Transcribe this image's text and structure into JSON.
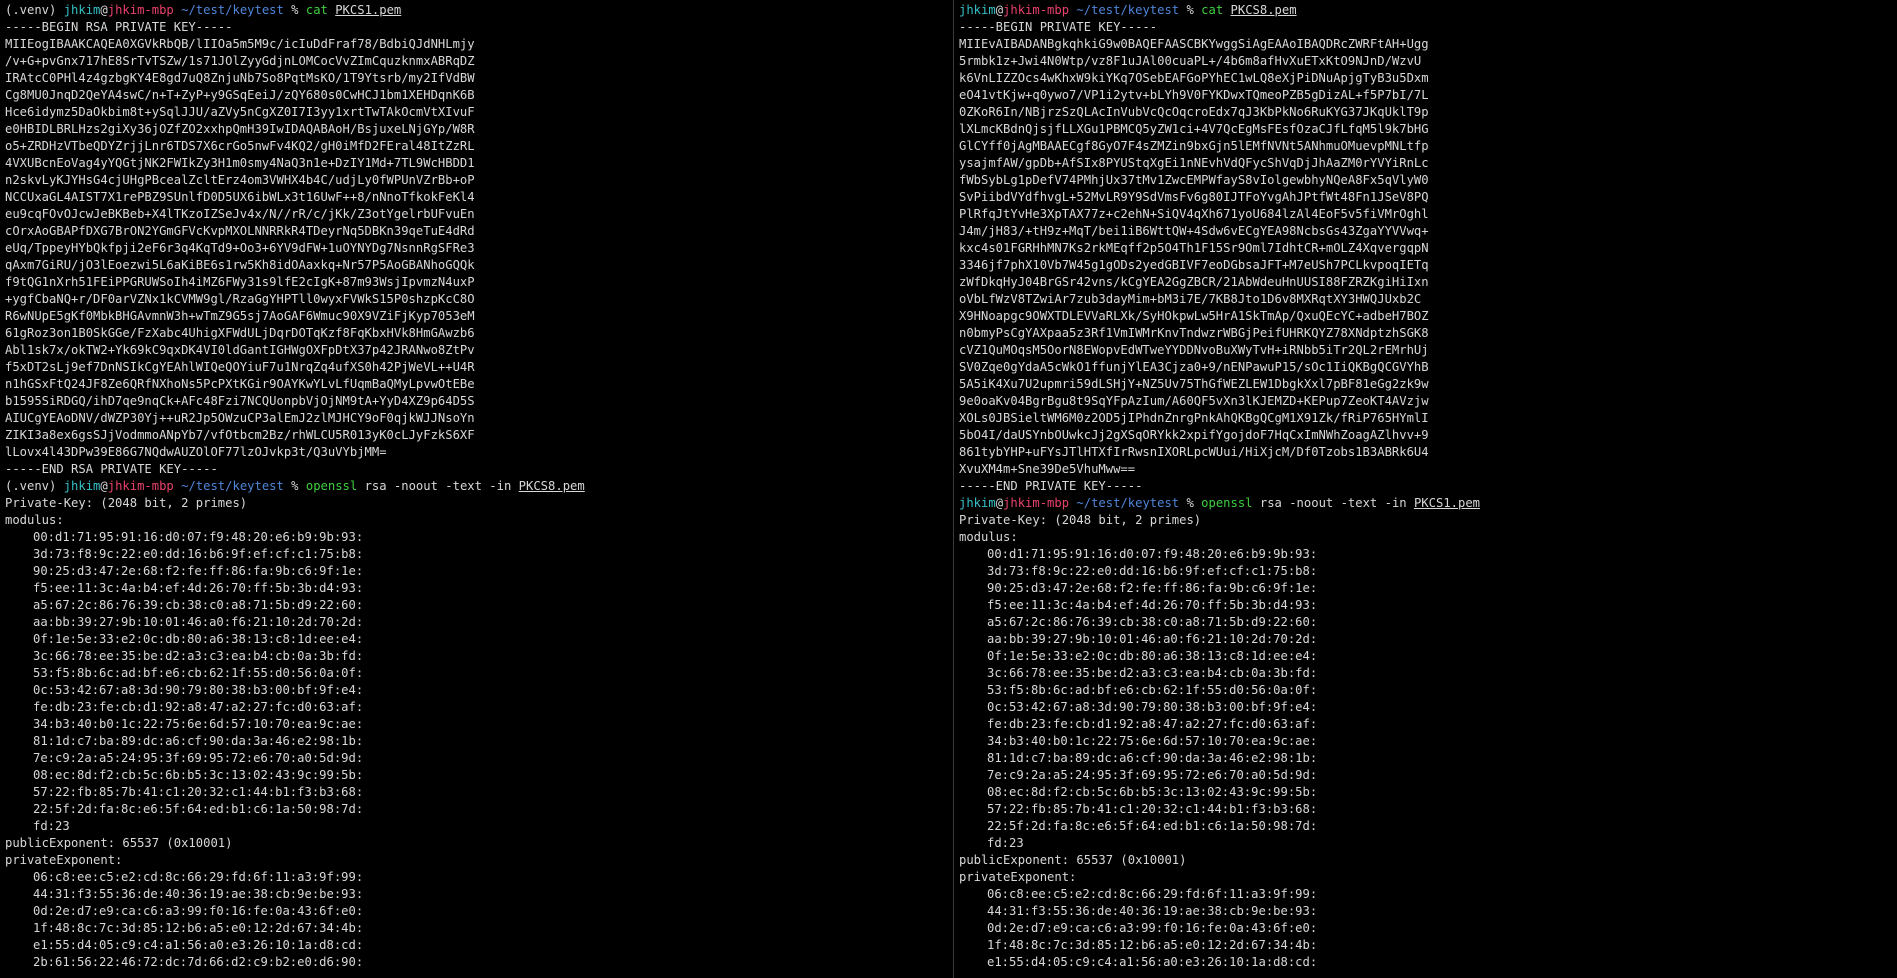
{
  "left": {
    "prompt1": {
      "venv": "(.venv) ",
      "user": "jhkim",
      "at": "@",
      "host": "jhkim-mbp",
      "path": " ~/test/keytest",
      "sym": " % ",
      "cmd": "cat",
      "arg": " ",
      "file": "PKCS1.pem"
    },
    "key_lines": [
      "-----BEGIN RSA PRIVATE KEY-----",
      "MIIEogIBAAKCAQEA0XGVkRbQB/lIIOa5m5M9c/icIuDdFraf78/BdbiQJdNHLmjy",
      "/v+G+pvGnx717hE8SrTvTSZw/1s71JOlZyyGdjnLOMCocVvZImCquzknmxABRqDZ",
      "IRAtcC0PHl4z4gzbgKY4E8gd7uQ8ZnjuNb7So8PqtMsKO/1T9Ytsrb/my2IfVdBW",
      "Cg8MU0JnqD2QeYA4swC/n+T+ZyP+y9GSqEeiJ/zQY680s0CwHCJ1bm1XEHDqnK6B",
      "Hce6idymz5DaOkbim8t+ySqlJJU/aZVy5nCgXZ0I7I3yy1xrtTwTAkOcmVtXIvuF",
      "e0HBIDLBRLHzs2giXy36jOZfZO2xxhpQmH39IwIDAQABAoH/BsjuxeLNjGYp/W8R",
      "o5+ZRDHzVTbeQDYZrjjLnr6TDS7X6crGo5nwFv4KQ2/gH0iMfD2FEral48ItZzRL",
      "4VXUBcnEoVag4yYQGtjNK2FWIkZy3H1m0smy4NaQ3n1e+DzIY1Md+7TL9WcHBDD1",
      "n2skvLyKJYHsG4cjUHgPBcealZcltErz4om3VWHX4b4C/udjLy0fWPUnVZrBb+oP",
      "NCCUxaGL4AIST7X1rePBZ9SUnlfD0D5UX6ibWLx3t16UwF++8/nNnoTfkokFeKl4",
      "eu9cqFOvOJcwJeBKBeb+X4lTKzoIZSeJv4x/N//rR/c/jKk/Z3otYgelrbUFvuEn",
      "cOrxAoGBAPfDXG7BrON2YGmGFVcKvpMXOLNNRRkR4TDeyrNq5DBKn39qeTuE4dRd",
      "eUq/TppeyHYbQkfpji2eF6r3q4KqTd9+Oo3+6YV9dFW+1uOYNYDg7NsnnRgSFRe3",
      "qAxm7GiRU/jO3lEoezwi5L6aKiBE6s1rw5Kh8idOAaxkq+Nr57P5AoGBANhoGQQk",
      "f9tQG1nXrh51FEiPPGRUWSoIh4iMZ6FWy31s9lfE2cIgK+87m93WsjIpvmzN4uxP",
      "+ygfCbaNQ+r/DF0arVZNx1kCVMW9gl/RzaGgYHPTll0wyxFVWkS15P0shzpKcC8O",
      "R6wNUpE5gKf0MbkBHGAvmnW3h+wTmZ9G5sj7AoGAF6Wmuc90X9VZiFjKyp7053eM",
      "61gRoz3on1B0SkGGe/FzXabc4UhigXFWdULjDqrDOTqKzf8FqKbxHVk8HmGAwzb6",
      "Abl1sk7x/okTW2+Yk69kC9qxDK4VI0ldGantIGHWgOXFpDtX37p42JRANwo8ZtPv",
      "f5xDT2sLj9ef7DnNSIkCgYEAhlWIQeQOYiuF7u1NrqZq4ufXS0h42PjWeVL++U4R",
      "n1hGSxFtQ24JF8Ze6QRfNXhoNs5PcPXtKGir9OAYKwYLvLfUqmBaQMyLpvwOtEBe",
      "b1595SiRDGQ/ihD7qe9nqCk+AFc48Fzi7NCQUonpbVjOjNM9tA+YyD4XZ9p64D5S",
      "AIUCgYEAoDNV/dWZP30Yj++uR2Jp5OWzuCP3alEmJ2zlMJHCY9oF0qjkWJJNsoYn",
      "ZIKI3a8ex6gsSJjVodmmoANpYb7/vfOtbcm2Bz/rhWLCU5R013yK0cLJyFzkS6XF",
      "lLovx4l43DPw39E86G7NQdwAUZOlOF77lzOJvkp3t/Q3uVYbjMM=",
      "-----END RSA PRIVATE KEY-----"
    ],
    "prompt2": {
      "venv": "(.venv) ",
      "user": "jhkim",
      "at": "@",
      "host": "jhkim-mbp",
      "path": " ~/test/keytest",
      "sym": " % ",
      "cmd": "openssl",
      "arg": " rsa -noout -text -in ",
      "file": "PKCS8.pem"
    },
    "private_key_header": "Private-Key: (2048 bit, 2 primes)",
    "modulus_label": "modulus:",
    "modulus_lines": [
      "00:d1:71:95:91:16:d0:07:f9:48:20:e6:b9:9b:93:",
      "3d:73:f8:9c:22:e0:dd:16:b6:9f:ef:cf:c1:75:b8:",
      "90:25:d3:47:2e:68:f2:fe:ff:86:fa:9b:c6:9f:1e:",
      "f5:ee:11:3c:4a:b4:ef:4d:26:70:ff:5b:3b:d4:93:",
      "a5:67:2c:86:76:39:cb:38:c0:a8:71:5b:d9:22:60:",
      "aa:bb:39:27:9b:10:01:46:a0:f6:21:10:2d:70:2d:",
      "0f:1e:5e:33:e2:0c:db:80:a6:38:13:c8:1d:ee:e4:",
      "3c:66:78:ee:35:be:d2:a3:c3:ea:b4:cb:0a:3b:fd:",
      "53:f5:8b:6c:ad:bf:e6:cb:62:1f:55:d0:56:0a:0f:",
      "0c:53:42:67:a8:3d:90:79:80:38:b3:00:bf:9f:e4:",
      "fe:db:23:fe:cb:d1:92:a8:47:a2:27:fc:d0:63:af:",
      "34:b3:40:b0:1c:22:75:6e:6d:57:10:70:ea:9c:ae:",
      "81:1d:c7:ba:89:dc:a6:cf:90:da:3a:46:e2:98:1b:",
      "7e:c9:2a:a5:24:95:3f:69:95:72:e6:70:a0:5d:9d:",
      "08:ec:8d:f2:cb:5c:6b:b5:3c:13:02:43:9c:99:5b:",
      "57:22:fb:85:7b:41:c1:20:32:c1:44:b1:f3:b3:68:",
      "22:5f:2d:fa:8c:e6:5f:64:ed:b1:c6:1a:50:98:7d:",
      "fd:23"
    ],
    "public_exponent": "publicExponent: 65537 (0x10001)",
    "private_exponent_label": "privateExponent:",
    "private_exponent_lines": [
      "06:c8:ee:c5:e2:cd:8c:66:29:fd:6f:11:a3:9f:99:",
      "44:31:f3:55:36:de:40:36:19:ae:38:cb:9e:be:93:",
      "0d:2e:d7:e9:ca:c6:a3:99:f0:16:fe:0a:43:6f:e0:",
      "1f:48:8c:7c:3d:85:12:b6:a5:e0:12:2d:67:34:4b:",
      "e1:55:d4:05:c9:c4:a1:56:a0:e3:26:10:1a:d8:cd:",
      "2b:61:56:22:46:72:dc:7d:66:d2:c9:b2:e0:d6:90:"
    ]
  },
  "right": {
    "prompt1": {
      "user": "jhkim",
      "at": "@",
      "host": "jhkim-mbp",
      "path": " ~/test/keytest",
      "sym": " % ",
      "cmd": "cat",
      "arg": " ",
      "file": "PKCS8.pem"
    },
    "key_lines": [
      "-----BEGIN PRIVATE KEY-----",
      "MIIEvAIBADANBgkqhkiG9w0BAQEFAASCBKYwggSiAgEAAoIBAQDRcZWRFtAH+Ugg",
      "5rmbk1z+Jwi4N0Wtp/vz8F1uJAl00cuaPL+/4b6m8afHvXuETxKtO9NJnD/WzvU",
      "k6VnLIZZOcs4wKhxW9kiYKq7OSebEAFGoPYhEC1wLQ8eXjPiDNuApjgTyB3u5Dxm",
      "eO41vtKjw+q0ywo7/VP1i2ytv+bLYh9V0FYKDwxTQmeoPZB5gDizAL+f5P7bI/7L",
      "0ZKoR6In/NBjrzSzQLAcInVubVcQcOqcroEdx7qJ3KbPkNo6RuKYG37JKqUklT9p",
      "lXLmcKBdnQjsjfLLXGu1PBMCQ5yZW1ci+4V7QcEgMsFEsfOzaCJfLfqM5l9k7bHG",
      "GlCYff0jAgMBAAECgf8GyO7F4sZMZin9bxGjn5lEMfNVNt5ANhmuOMuevpMNLtfp",
      "ysajmfAW/gpDb+AfSIx8PYUStqXgEi1nNEvhVdQFycShVqDjJhAaZM0rYVYiRnLc",
      "fWbSybLg1pDefV74PMhjUx37tMv1ZwcEMPWfayS8vIolgewbhyNQeA8Fx5qVlyW0",
      "SvPiibdVYdfhvgL+52MvLR9Y9SdVmsFv6g80IJTFoYvgAhJPtfWt48Fn1JSeV8PQ",
      "PlRfqJtYvHe3XpTAX77z+c2ehN+SiQV4qXh671yoU684lzAl4EoF5v5fiVMrOghl",
      "J4m/jH83/+tH9z+MqT/bei1iB6WttQW+4Sdw6vECgYEA98NcbsGs43ZgaYYVVwq+",
      "kxc4s01FGRHhMN7Ks2rkMEqff2p5O4Th1F15Sr9Oml7IdhtCR+mOLZ4XqvergqpN",
      "3346jf7phX10Vb7W45g1gODs2yedGBIVF7eoDGbsaJFT+M7eUSh7PCLkvpoqIETq",
      "zWfDkqHyJ04BrGSr42vns/kCgYEA2GgZBCR/21AbWdeuHnUUSI88FZRZKgiHiIxn",
      "oVbLfWzV8TZwiAr7zub3dayMim+bM3i7E/7KB8Jto1D6v8MXRqtXY3HWQJUxb2C",
      "X9HNoapgc9OWXTDLEVVaRLXk/SyHOkpwLw5HrA1SkTmAp/QxuQEcYC+adbeH7BOZ",
      "n0bmyPsCgYAXpaa5z3Rf1VmIWMrKnvTndwzrWBGjPeifUHRKQYZ78XNdptzhSGK8",
      "cVZ1QuMOqsM5OorN8EWopvEdWTweYYDDNvoBuXWyTvH+iRNbb5iTr2QL2rEMrhUj",
      "SV0Zqe0gYdaA5cWkO1ffunjYlEA3Cjza0+9/nENPawuP15/sOc1IiQKBgQCGVYhB",
      "5A5iK4Xu7U2upmri59dLSHjY+NZ5Uv75ThGfWEZLEW1DbgkXxl7pBF81eGg2zk9w",
      "9e0oaKv04BgrBgu8t9SqYFpAzIum/A60QF5vXn3lKJEMZD+KEPup7ZeoKT4AVzjw",
      "XOLs0JBSieltWM6M0z2OD5jIPhdnZnrgPnkAhQKBgQCgM1X91Zk/fRiP765HYmlI",
      "5bO4I/daUSYnbOUwkcJj2gXSqORYkk2xpifYgojdoF7HqCxImNWhZoagAZlhvv+9",
      "861tybYHP+uFYsJTlHTXfIrRwsnIXORLpcWUui/HiXjcM/Df0Tzobs1B3ABRk6U4",
      "XvuXM4m+Sne39De5VhuMww==",
      "-----END PRIVATE KEY-----"
    ],
    "prompt2": {
      "user": "jhkim",
      "at": "@",
      "host": "jhkim-mbp",
      "path": " ~/test/keytest",
      "sym": " % ",
      "cmd": "openssl",
      "arg": " rsa -noout -text -in ",
      "file": "PKCS1.pem"
    },
    "private_key_header": "Private-Key: (2048 bit, 2 primes)",
    "modulus_label": "modulus:",
    "modulus_lines": [
      "00:d1:71:95:91:16:d0:07:f9:48:20:e6:b9:9b:93:",
      "3d:73:f8:9c:22:e0:dd:16:b6:9f:ef:cf:c1:75:b8:",
      "90:25:d3:47:2e:68:f2:fe:ff:86:fa:9b:c6:9f:1e:",
      "f5:ee:11:3c:4a:b4:ef:4d:26:70:ff:5b:3b:d4:93:",
      "a5:67:2c:86:76:39:cb:38:c0:a8:71:5b:d9:22:60:",
      "aa:bb:39:27:9b:10:01:46:a0:f6:21:10:2d:70:2d:",
      "0f:1e:5e:33:e2:0c:db:80:a6:38:13:c8:1d:ee:e4:",
      "3c:66:78:ee:35:be:d2:a3:c3:ea:b4:cb:0a:3b:fd:",
      "53:f5:8b:6c:ad:bf:e6:cb:62:1f:55:d0:56:0a:0f:",
      "0c:53:42:67:a8:3d:90:79:80:38:b3:00:bf:9f:e4:",
      "fe:db:23:fe:cb:d1:92:a8:47:a2:27:fc:d0:63:af:",
      "34:b3:40:b0:1c:22:75:6e:6d:57:10:70:ea:9c:ae:",
      "81:1d:c7:ba:89:dc:a6:cf:90:da:3a:46:e2:98:1b:",
      "7e:c9:2a:a5:24:95:3f:69:95:72:e6:70:a0:5d:9d:",
      "08:ec:8d:f2:cb:5c:6b:b5:3c:13:02:43:9c:99:5b:",
      "57:22:fb:85:7b:41:c1:20:32:c1:44:b1:f3:b3:68:",
      "22:5f:2d:fa:8c:e6:5f:64:ed:b1:c6:1a:50:98:7d:",
      "fd:23"
    ],
    "public_exponent": "publicExponent: 65537 (0x10001)",
    "private_exponent_label": "privateExponent:",
    "private_exponent_lines": [
      "06:c8:ee:c5:e2:cd:8c:66:29:fd:6f:11:a3:9f:99:",
      "44:31:f3:55:36:de:40:36:19:ae:38:cb:9e:be:93:",
      "0d:2e:d7:e9:ca:c6:a3:99:f0:16:fe:0a:43:6f:e0:",
      "1f:48:8c:7c:3d:85:12:b6:a5:e0:12:2d:67:34:4b:",
      "e1:55:d4:05:c9:c4:a1:56:a0:e3:26:10:1a:d8:cd:"
    ]
  },
  "colors": {
    "background": "#000000",
    "text": "#d8d8d8",
    "user": "#35c0c6",
    "host": "#e8426b",
    "path": "#4f86d9",
    "command": "#3fcf3f"
  }
}
